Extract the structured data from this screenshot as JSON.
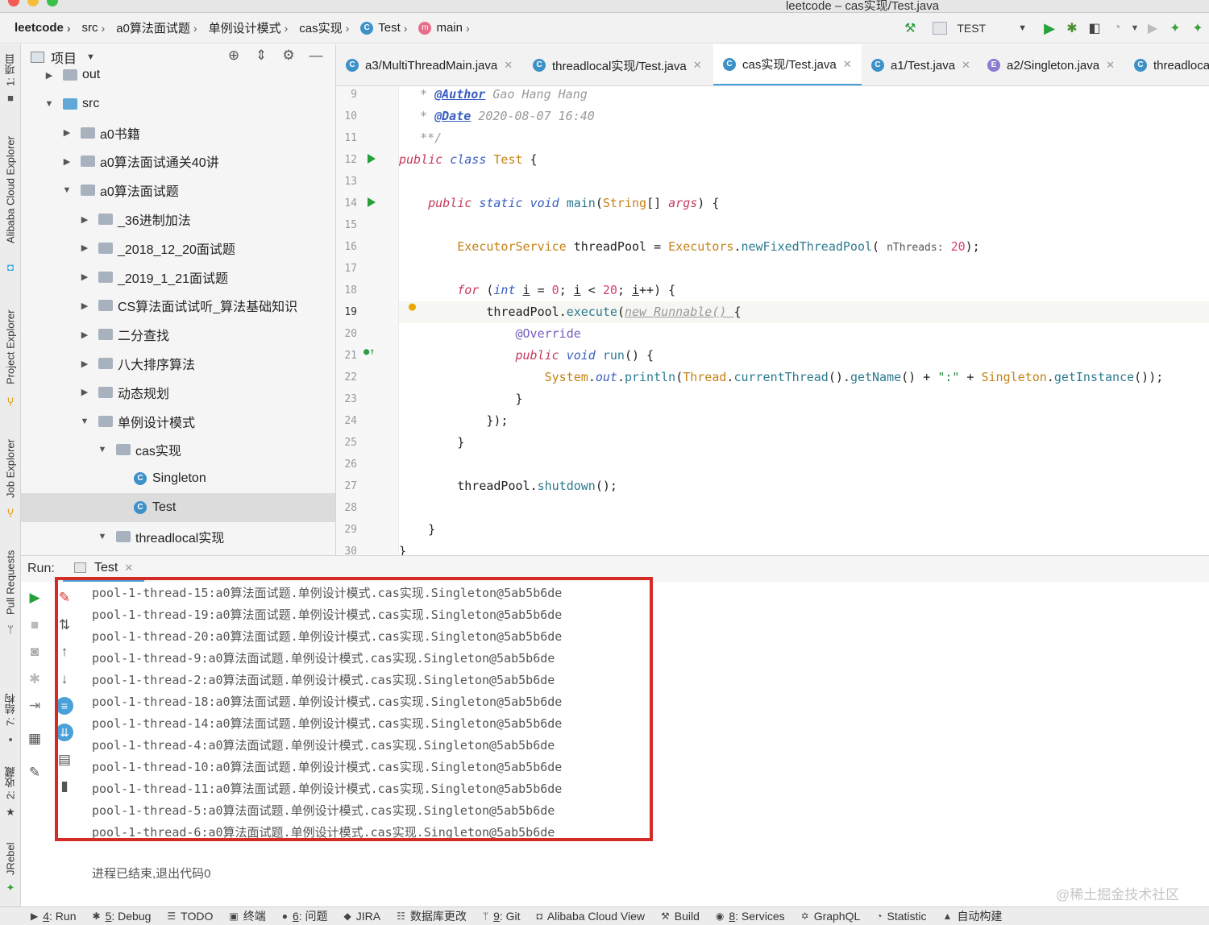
{
  "window": {
    "title": "leetcode – cas实现/Test.java"
  },
  "breadcrumbs": [
    {
      "label": "leetcode",
      "kind": "project"
    },
    {
      "label": "src",
      "kind": "folder"
    },
    {
      "label": "a0算法面试题",
      "kind": "folder"
    },
    {
      "label": "单例设计模式",
      "kind": "folder"
    },
    {
      "label": "cas实现",
      "kind": "folder"
    },
    {
      "label": "Test",
      "kind": "class"
    },
    {
      "label": "main",
      "kind": "method"
    }
  ],
  "run_config": {
    "label": "TEST"
  },
  "left_tool_tabs": [
    "1: 项目",
    "Alibaba Cloud Explorer",
    "Project Explorer",
    "Job Explorer",
    "Pull Requests",
    "7: 结构",
    "2: 收藏",
    "JRebel"
  ],
  "project_panel": {
    "title": "项目",
    "tree": [
      {
        "label": "out",
        "depth": 1,
        "expanded": false
      },
      {
        "label": "src",
        "depth": 1,
        "expanded": true,
        "kind": "src"
      },
      {
        "label": "a0书籍",
        "depth": 2,
        "expanded": false
      },
      {
        "label": "a0算法面试通关40讲",
        "depth": 2,
        "expanded": false
      },
      {
        "label": "a0算法面试题",
        "depth": 2,
        "expanded": true
      },
      {
        "label": "_36进制加法",
        "depth": 3,
        "expanded": false
      },
      {
        "label": "_2018_12_20面试题",
        "depth": 3,
        "expanded": false
      },
      {
        "label": "_2019_1_21面试题",
        "depth": 3,
        "expanded": false
      },
      {
        "label": "CS算法面试试听_算法基础知识",
        "depth": 3,
        "expanded": false
      },
      {
        "label": "二分查找",
        "depth": 3,
        "expanded": false
      },
      {
        "label": "八大排序算法",
        "depth": 3,
        "expanded": false
      },
      {
        "label": "动态规划",
        "depth": 3,
        "expanded": false
      },
      {
        "label": "单例设计模式",
        "depth": 3,
        "expanded": true
      },
      {
        "label": "cas实现",
        "depth": 4,
        "expanded": true
      },
      {
        "label": "Singleton",
        "depth": 5,
        "kind": "class"
      },
      {
        "label": "Test",
        "depth": 5,
        "kind": "class",
        "selected": true
      },
      {
        "label": "threadlocal实现",
        "depth": 4,
        "expanded": true
      },
      {
        "label": "Singleton",
        "depth": 5,
        "kind": "class"
      }
    ]
  },
  "editor_tabs": [
    {
      "label": "a3/MultiThreadMain.java",
      "icon": "C",
      "active": false
    },
    {
      "label": "threadlocal实现/Test.java",
      "icon": "C",
      "active": false
    },
    {
      "label": "cas实现/Test.java",
      "icon": "C",
      "active": true
    },
    {
      "label": "a1/Test.java",
      "icon": "C",
      "active": false
    },
    {
      "label": "a2/Singleton.java",
      "icon": "E",
      "active": false
    },
    {
      "label": "threadloca",
      "icon": "C",
      "active": false
    }
  ],
  "code": {
    "lines": [
      {
        "n": "9",
        "comment_tag": "@Author",
        "comment_text": " Gao Hang Hang"
      },
      {
        "n": "10",
        "comment_tag": "@Date",
        "comment_text": " 2020-08-07 16:40"
      },
      {
        "n": "11",
        "close": "**/"
      },
      {
        "n": "12"
      },
      {
        "n": "13"
      },
      {
        "n": "14"
      },
      {
        "n": "15"
      },
      {
        "n": "16"
      },
      {
        "n": "17"
      },
      {
        "n": "18"
      },
      {
        "n": "19"
      },
      {
        "n": "20"
      },
      {
        "n": "21"
      },
      {
        "n": "22"
      },
      {
        "n": "23"
      },
      {
        "n": "24"
      },
      {
        "n": "25"
      },
      {
        "n": "26"
      },
      {
        "n": "27"
      },
      {
        "n": "28"
      },
      {
        "n": "29"
      },
      {
        "n": "30"
      }
    ],
    "tokens": {
      "public": "public",
      "class": "class",
      "class_name": "Test",
      "static": "static",
      "void": "void",
      "main": "main",
      "string": "String",
      "args_sig": "[] ",
      "args": "args",
      "executor_service": "ExecutorService",
      "thread_pool": "threadPool",
      "executors": "Executors",
      "new_fixed": "newFixedThreadPool",
      "n_threads_hint": "nThreads:",
      "twenty": "20",
      "for": "for",
      "int": "int",
      "i": "i",
      "zero": "0",
      "execute": "execute",
      "new_runnable": "new Runnable() ",
      "override": "@Override",
      "run": "run",
      "system": "System",
      "out": "out",
      "println": "println",
      "thread": "Thread",
      "current_thread": "currentThread",
      "get_name": "getName",
      "colon_str": "\":\"",
      "singleton": "Singleton",
      "get_instance": "getInstance",
      "shutdown": "shutdown"
    }
  },
  "run_panel": {
    "label": "Run:",
    "tab": "Test",
    "output": [
      "pool-1-thread-15:a0算法面试题.单例设计模式.cas实现.Singleton@5ab5b6de",
      "pool-1-thread-19:a0算法面试题.单例设计模式.cas实现.Singleton@5ab5b6de",
      "pool-1-thread-20:a0算法面试题.单例设计模式.cas实现.Singleton@5ab5b6de",
      "pool-1-thread-9:a0算法面试题.单例设计模式.cas实现.Singleton@5ab5b6de",
      "pool-1-thread-2:a0算法面试题.单例设计模式.cas实现.Singleton@5ab5b6de",
      "pool-1-thread-18:a0算法面试题.单例设计模式.cas实现.Singleton@5ab5b6de",
      "pool-1-thread-14:a0算法面试题.单例设计模式.cas实现.Singleton@5ab5b6de",
      "pool-1-thread-4:a0算法面试题.单例设计模式.cas实现.Singleton@5ab5b6de",
      "pool-1-thread-10:a0算法面试题.单例设计模式.cas实现.Singleton@5ab5b6de",
      "pool-1-thread-11:a0算法面试题.单例设计模式.cas实现.Singleton@5ab5b6de",
      "pool-1-thread-5:a0算法面试题.单例设计模式.cas实现.Singleton@5ab5b6de",
      "pool-1-thread-6:a0算法面试题.单例设计模式.cas实现.Singleton@5ab5b6de"
    ],
    "exit_message": "进程已结束,退出代码0"
  },
  "watermark": "@稀土掘金技术社区",
  "statusbar": [
    {
      "num": "4",
      "label": ": Run",
      "icon": "play-icon"
    },
    {
      "num": "5",
      "label": ": Debug",
      "icon": "bug-icon"
    },
    {
      "num": "",
      "label": "TODO",
      "icon": "list-icon"
    },
    {
      "num": "",
      "label": "终端",
      "icon": "terminal-icon"
    },
    {
      "num": "6",
      "label": ": 问题",
      "icon": "problem-icon"
    },
    {
      "num": "",
      "label": "JIRA",
      "icon": "jira-icon"
    },
    {
      "num": "",
      "label": "数据库更改",
      "icon": "database-icon"
    },
    {
      "num": "9",
      "label": ": Git",
      "icon": "git-icon"
    },
    {
      "num": "",
      "label": "Alibaba Cloud View",
      "icon": "cloud-icon"
    },
    {
      "num": "",
      "label": "Build",
      "icon": "hammer-icon"
    },
    {
      "num": "8",
      "label": ": Services",
      "icon": "services-icon"
    },
    {
      "num": "",
      "label": "GraphQL",
      "icon": "graphql-icon"
    },
    {
      "num": "",
      "label": "Statistic",
      "icon": "statistic-icon"
    },
    {
      "num": "",
      "label": "自动构建",
      "icon": "warning-icon"
    }
  ],
  "colors": {
    "accent": "#4aa0d8",
    "highlight_box": "#d42b26",
    "run_green": "#25a13a"
  }
}
